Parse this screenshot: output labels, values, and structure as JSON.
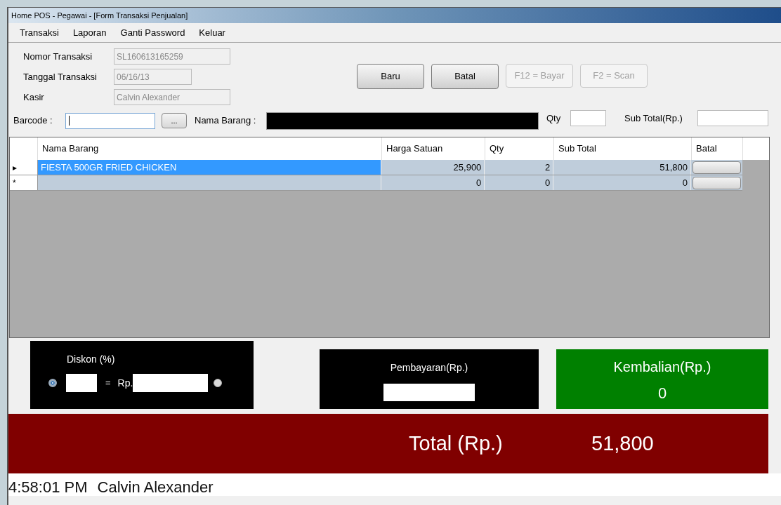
{
  "window": {
    "title": "Home POS - Pegawai - [Form Transaksi Penjualan]"
  },
  "menu": [
    "Transaksi",
    "Laporan",
    "Ganti Password",
    "Keluar"
  ],
  "header_fields": [
    {
      "label": "Nomor Transaksi",
      "value": "SL160613165259",
      "disabled": true
    },
    {
      "label": "Tanggal Transaksi",
      "value": "06/16/13",
      "disabled": true
    },
    {
      "label": "Kasir",
      "value": "Calvin Alexander",
      "disabled": true
    }
  ],
  "buttons": [
    {
      "label": "Baru",
      "disabled": false
    },
    {
      "label": "Batal",
      "disabled": false
    },
    {
      "label": "F12 = Bayar",
      "disabled": true
    },
    {
      "label": "F2 = Scan",
      "disabled": true
    }
  ],
  "entry": {
    "barcode_label": "Barcode :",
    "browse_button": "...",
    "nama_barang_label": "Nama Barang :",
    "qty_label": "Qty",
    "subtotal_label": "Sub Total(Rp.)"
  },
  "table": {
    "columns": [
      "Nama Barang",
      "Harga Satuan",
      "Qty",
      "Sub Total",
      "Batal"
    ],
    "rows": [
      {
        "marker": "▸",
        "selected": true,
        "cells": [
          "FIESTA 500GR FRIED CHICKEN",
          "25,900",
          "2",
          "51,800"
        ]
      },
      {
        "marker": "*",
        "selected": false,
        "cells": [
          "",
          "0",
          "0",
          "0"
        ]
      }
    ]
  },
  "discount": {
    "title": "Diskon (%)",
    "equals": "=",
    "currency": "Rp.",
    "options": [
      {
        "selected": true
      },
      {
        "selected": false
      }
    ]
  },
  "payment": {
    "title": "Pembayaran(Rp.)"
  },
  "change": {
    "title": "Kembalian(Rp.)",
    "value": "0"
  },
  "total": {
    "label": "Total (Rp.)",
    "value": "51,800"
  },
  "status_bar": {
    "time": "4:58:01 PM",
    "user": "Calvin Alexander"
  }
}
